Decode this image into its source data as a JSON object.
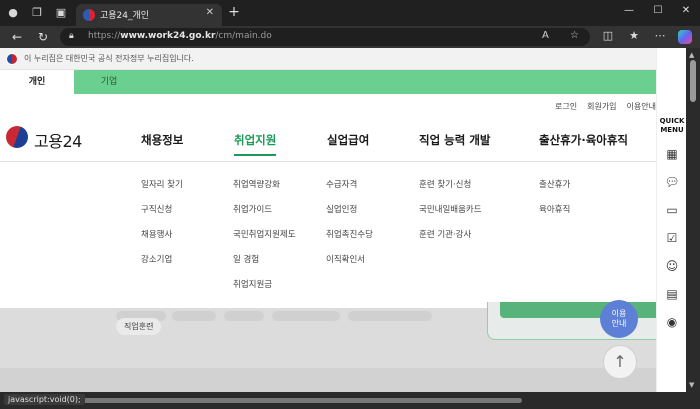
{
  "browser": {
    "tab_title": "고용24_개인",
    "url_prefix": "https://",
    "url_domain": "www.work24.go.kr",
    "url_path": "/cm/main.do",
    "status_url": "javascript:void(0);"
  },
  "gov_banner": {
    "text": "이 누리집은 대한민국 공식 전자정부 누리집입니다."
  },
  "user_tabs": {
    "personal": "개인",
    "corporate": "기업"
  },
  "util_links": {
    "login": "로그인",
    "signup": "회원가입",
    "guide": "이용안내"
  },
  "logo": {
    "text": "고용24"
  },
  "gnb": [
    {
      "label": "채용정보",
      "sub": [
        "일자리 찾기",
        "구직신청",
        "채용행사",
        "강소기업"
      ]
    },
    {
      "label": "취업지원",
      "sub": [
        "취업역량강화",
        "취업가이드",
        "국민취업지원제도",
        "일 경험",
        "취업지원금"
      ]
    },
    {
      "label": "실업급여",
      "sub": [
        "수급자격",
        "실업인정",
        "취업촉진수당",
        "이직확인서"
      ]
    },
    {
      "label": "직업 능력 개발",
      "sub": [
        "훈련 찾기·신청",
        "국민내일배움카드",
        "훈련 기관·강사"
      ]
    },
    {
      "label": "출산휴가·육아휴직",
      "sub": [
        "출산휴가",
        "육아휴직"
      ]
    }
  ],
  "background": {
    "chip": "직업훈련",
    "usage_button": "이용\n안내"
  },
  "quick_menu": {
    "title": "QUICK\nMENU"
  },
  "colors": {
    "accent": "#1e9a57",
    "tab_bar": "#6bd08f",
    "usage_button": "#5d7fd6"
  }
}
